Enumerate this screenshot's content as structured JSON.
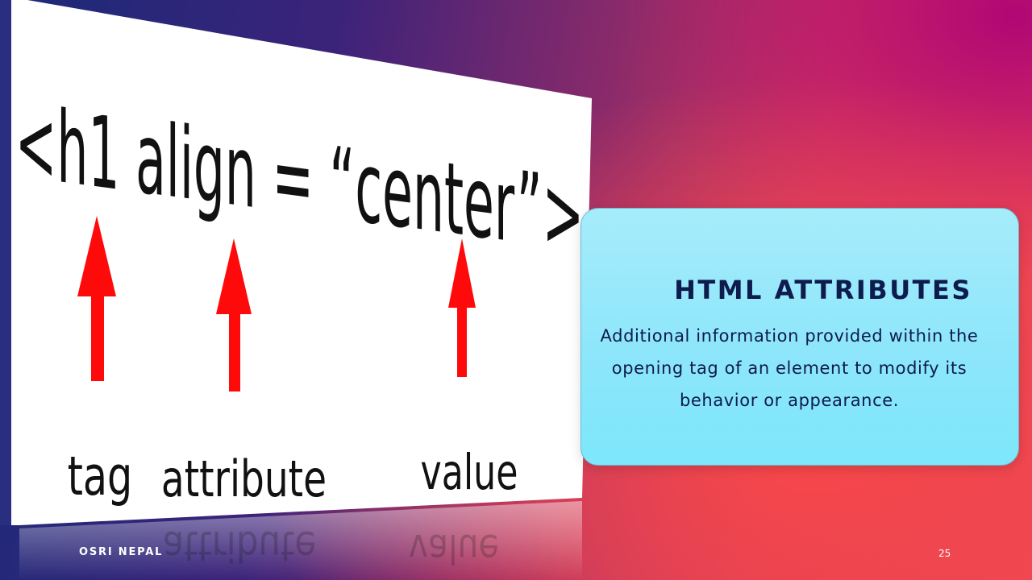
{
  "slide": {
    "title": "HTML ATTRIBUTES",
    "description": "Additional information provided within the opening tag of an element to modify its behavior or appearance.",
    "footer": "OSRI NEPAL",
    "page_number": "25"
  },
  "illustration": {
    "code": "<h1 align = “center”>",
    "labels": {
      "tag": "tag",
      "attribute": "attribute",
      "value": "value"
    },
    "reflection": {
      "attribute": "attribute",
      "value": "value"
    },
    "arrow_color": "#ff0a0a",
    "image_bg": "#ffffff"
  },
  "colors": {
    "box_fill": "#8ee6fb",
    "title_text": "#0e1b4d",
    "footer_text": "#ffffff"
  }
}
